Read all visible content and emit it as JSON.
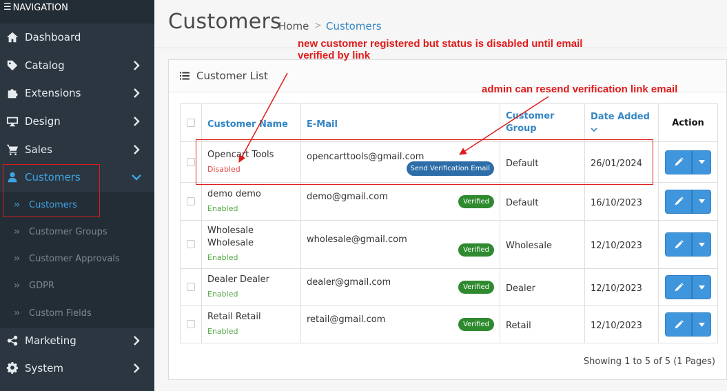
{
  "sidebar": {
    "header": "NAVIGATION",
    "items": [
      {
        "label": "Dashboard",
        "icon": "home-icon"
      },
      {
        "label": "Catalog",
        "icon": "tag-icon"
      },
      {
        "label": "Extensions",
        "icon": "puzzle-icon"
      },
      {
        "label": "Design",
        "icon": "desktop-icon"
      },
      {
        "label": "Sales",
        "icon": "cart-icon"
      },
      {
        "label": "Customers",
        "icon": "user-icon"
      },
      {
        "label": "Marketing",
        "icon": "share-icon"
      },
      {
        "label": "System",
        "icon": "gear-icon"
      }
    ],
    "sub_items": [
      {
        "label": "Customers"
      },
      {
        "label": "Customer Groups"
      },
      {
        "label": "Customer Approvals"
      },
      {
        "label": "GDPR"
      },
      {
        "label": "Custom Fields"
      }
    ]
  },
  "header": {
    "title": "Customers",
    "breadcrumb": {
      "home": "Home",
      "separator": ">",
      "current": "Customers"
    }
  },
  "panel": {
    "title": "Customer List",
    "columns": {
      "name": "Customer Name",
      "email": "E-Mail",
      "group": "Customer Group",
      "date": "Date Added",
      "action": "Action"
    },
    "rows": [
      {
        "name": "Opencart Tools",
        "status": "Disabled",
        "email": "opencarttools@gmail.com",
        "badge": "Send Verification Email",
        "group": "Default",
        "date": "26/01/2024"
      },
      {
        "name": "demo demo",
        "status": "Enabled",
        "email": "demo@gmail.com",
        "badge": "Verified",
        "group": "Default",
        "date": "16/10/2023"
      },
      {
        "name": "Wholesale Wholesale",
        "status": "Enabled",
        "email": "wholesale@gmail.com",
        "badge": "Verified",
        "group": "Wholesale",
        "date": "12/10/2023"
      },
      {
        "name": "Dealer Dealer",
        "status": "Enabled",
        "email": "dealer@gmail.com",
        "badge": "Verified",
        "group": "Dealer",
        "date": "12/10/2023"
      },
      {
        "name": "Retail Retail",
        "status": "Enabled",
        "email": "retail@gmail.com",
        "badge": "Verified",
        "group": "Retail",
        "date": "12/10/2023"
      }
    ],
    "pagination": "Showing 1 to 5 of 5 (1 Pages)"
  },
  "annotations": {
    "note1": "new customer registered but status is disabled until email verified by link",
    "note2": "admin can resend verification link email"
  },
  "colors": {
    "sidebar_bg": "#2b3640",
    "accent": "#3fa4e6",
    "verified_badge": "#2f8a2f",
    "send_badge": "#2d6da8",
    "annotation": "#e01b1b"
  }
}
